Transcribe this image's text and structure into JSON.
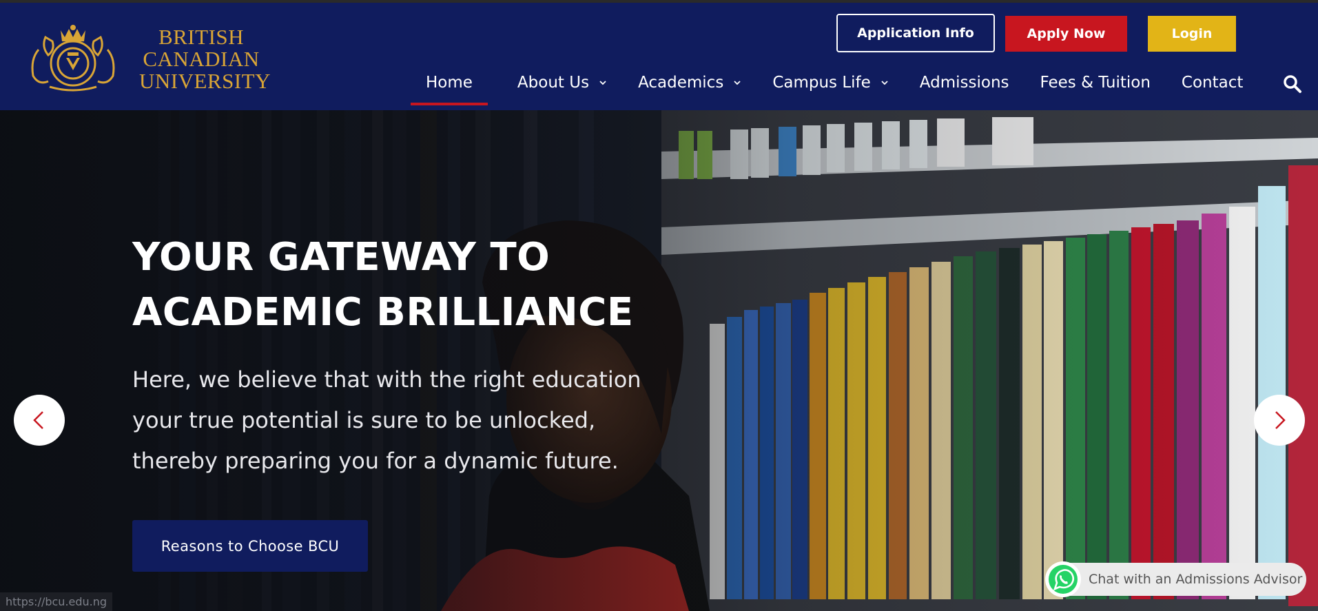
{
  "brand": {
    "name_lines": [
      "British",
      "Canadian",
      "University"
    ],
    "gold": "#d9a536",
    "navy": "#101c5e",
    "red": "#c8161f",
    "yellow": "#e2b417"
  },
  "top_buttons": {
    "application_info": "Application Info",
    "apply_now": "Apply Now",
    "login": "Login"
  },
  "nav": {
    "items": [
      {
        "label": "Home",
        "active": true,
        "dropdown": false
      },
      {
        "label": "About Us",
        "active": false,
        "dropdown": true
      },
      {
        "label": "Academics",
        "active": false,
        "dropdown": true
      },
      {
        "label": "Campus Life",
        "active": false,
        "dropdown": true
      },
      {
        "label": "Admissions",
        "active": false,
        "dropdown": false
      },
      {
        "label": "Fees & Tuition",
        "active": false,
        "dropdown": false
      },
      {
        "label": "Contact",
        "active": false,
        "dropdown": false
      }
    ],
    "search_icon": "search-icon"
  },
  "hero": {
    "title_lines": [
      "YOUR GATEWAY TO",
      "ACADEMIC BRILLIANCE"
    ],
    "body_lines": [
      "Here, we believe that with the right education",
      "your true potential is sure to be unlocked,",
      "thereby preparing you for a dynamic future."
    ],
    "cta": "Reasons to Choose BCU",
    "prev_icon": "chevron-left-icon",
    "next_icon": "chevron-right-icon"
  },
  "status_bar": {
    "url": "https://bcu.edu.ng"
  },
  "chat_widget": {
    "label": "Chat with an Admissions Advisor",
    "icon": "whatsapp-icon"
  }
}
